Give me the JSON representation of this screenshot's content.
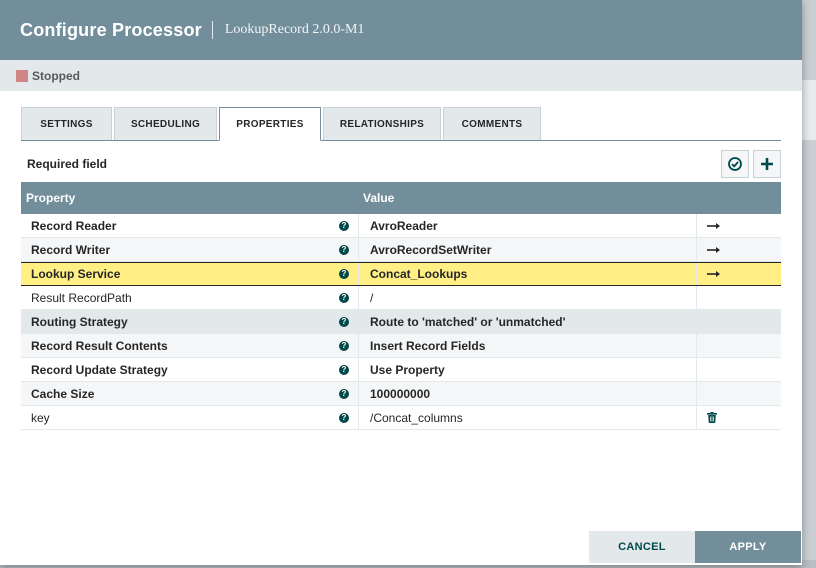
{
  "dialog": {
    "title": "Configure Processor",
    "subtitle": "LookupRecord 2.0.0-M1"
  },
  "status": {
    "label": "Stopped",
    "color": "#d18686"
  },
  "tabs": [
    {
      "label": "SETTINGS",
      "active": false
    },
    {
      "label": "SCHEDULING",
      "active": false
    },
    {
      "label": "PROPERTIES",
      "active": true
    },
    {
      "label": "RELATIONSHIPS",
      "active": false
    },
    {
      "label": "COMMENTS",
      "active": false
    }
  ],
  "required_field_label": "Required field",
  "table": {
    "headers": {
      "property": "Property",
      "value": "Value"
    },
    "rows": [
      {
        "property": "Record Reader",
        "value": "AvroReader",
        "action": "arrow"
      },
      {
        "property": "Record Writer",
        "value": "AvroRecordSetWriter",
        "action": "arrow"
      },
      {
        "property": "Lookup Service",
        "value": "Concat_Lookups",
        "action": "arrow",
        "selected": true
      },
      {
        "property": "Result RecordPath",
        "value": "/",
        "action": ""
      },
      {
        "property": "Routing Strategy",
        "value": "Route to 'matched' or 'unmatched'",
        "action": ""
      },
      {
        "property": "Record Result Contents",
        "value": "Insert Record Fields",
        "action": ""
      },
      {
        "property": "Record Update Strategy",
        "value": "Use Property",
        "action": ""
      },
      {
        "property": "Cache Size",
        "value": "100000000",
        "action": ""
      },
      {
        "property": "key",
        "value": "/Concat_columns",
        "action": "trash"
      }
    ]
  },
  "buttons": {
    "cancel": "CANCEL",
    "apply": "APPLY"
  },
  "colors": {
    "header": "#728e9b",
    "selected_row": "#ffef85",
    "accent_dark": "#004849"
  }
}
